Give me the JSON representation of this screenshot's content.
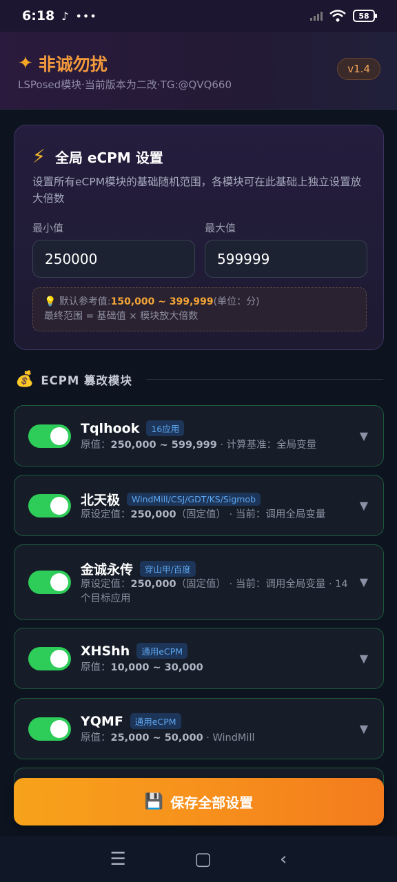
{
  "status": {
    "time": "6:18",
    "battery": "58"
  },
  "header": {
    "title": "非诚勿扰",
    "subtitle": "LSPosed模块·当前版本为二改·TG:@QVQ660",
    "version": "v1.4"
  },
  "global": {
    "title": "全局 eCPM 设置",
    "description": "设置所有eCPM模块的基础随机范围，各模块可在此基础上独立设置放大倍数",
    "min_label": "最小值",
    "max_label": "最大值",
    "min_value": "250000",
    "max_value": "599999",
    "hint_prefix": "默认参考值:",
    "hint_value": "150,000 ~ 399,999",
    "hint_unit": "(单位：分)",
    "hint_line2": "最终范围 = 基础值 × 模块放大倍数"
  },
  "section": {
    "title": "ECPM 篡改模块"
  },
  "modules": [
    {
      "name": "Tqlhook",
      "tag": "16应用",
      "info_a": "原值：",
      "info_b": "250,000 ~ 599,999",
      "info_c": " · 计算基准：全局变量",
      "enabled": true
    },
    {
      "name": "北天极",
      "tag": "WindMill/CSJ/GDT/KS/Sigmob",
      "info_a": "原设定值：",
      "info_b": "250,000",
      "info_c": "（固定值） · 当前：调用全局变量",
      "enabled": true
    },
    {
      "name": "金诚永传",
      "tag": "穿山甲/百度",
      "info_a": "原设定值：",
      "info_b": "250,000",
      "info_c": "（固定值） · 当前：调用全局变量 · 14个目标应用",
      "enabled": true
    },
    {
      "name": "XHShh",
      "tag": "通用eCPM",
      "info_a": "原值：",
      "info_b": "10,000 ~ 30,000",
      "info_c": "",
      "enabled": true
    },
    {
      "name": "YQMF",
      "tag": "通用eCPM",
      "info_a": "原值：",
      "info_b": "25,000 ~ 50,000",
      "info_c": " · WindMill",
      "enabled": true
    }
  ],
  "save_label": "保存全部设置"
}
